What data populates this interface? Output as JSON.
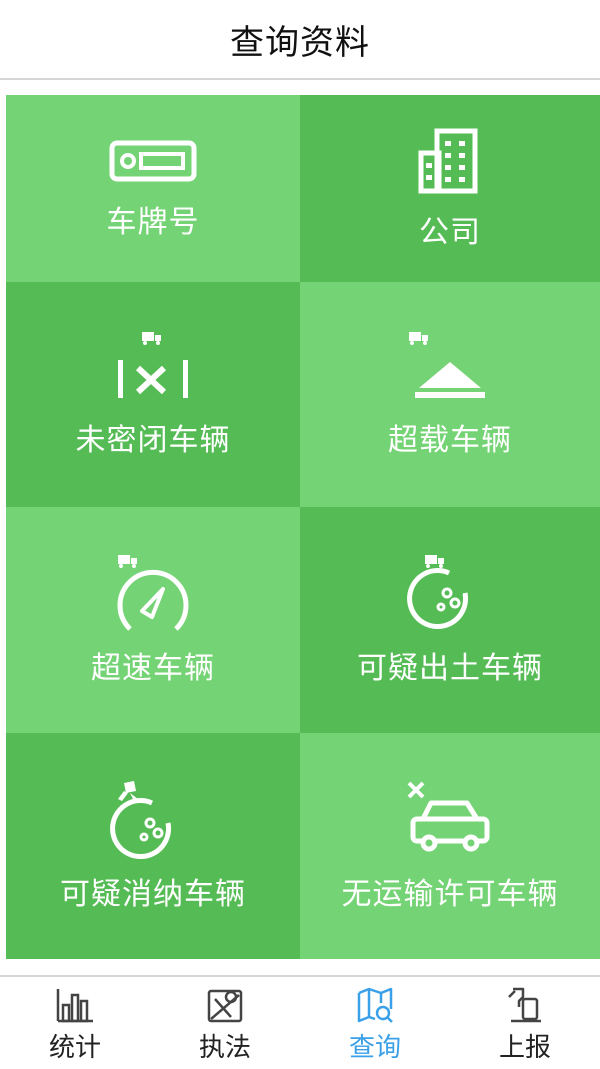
{
  "header": {
    "title": "查询资料"
  },
  "tiles": [
    {
      "label": "车牌号",
      "icon": "license-plate-icon"
    },
    {
      "label": "公司",
      "icon": "building-icon"
    },
    {
      "label": "未密闭车辆",
      "icon": "unsealed-truck-icon"
    },
    {
      "label": "超载车辆",
      "icon": "overload-icon"
    },
    {
      "label": "超速车辆",
      "icon": "speedometer-icon"
    },
    {
      "label": "可疑出土车辆",
      "icon": "soil-truck-icon"
    },
    {
      "label": "可疑消纳车辆",
      "icon": "disposal-icon"
    },
    {
      "label": "无运输许可车辆",
      "icon": "no-permit-car-icon"
    }
  ],
  "tabbar": {
    "items": [
      {
        "label": "统计",
        "icon": "bar-chart-icon"
      },
      {
        "label": "执法",
        "icon": "map-pin-icon"
      },
      {
        "label": "查询",
        "icon": "search-map-icon"
      },
      {
        "label": "上报",
        "icon": "report-icon"
      }
    ],
    "active": "查询"
  },
  "colors": {
    "tile_light": "#74d374",
    "tile_dark": "#55bc55",
    "active_tab": "#3aa0e8"
  }
}
